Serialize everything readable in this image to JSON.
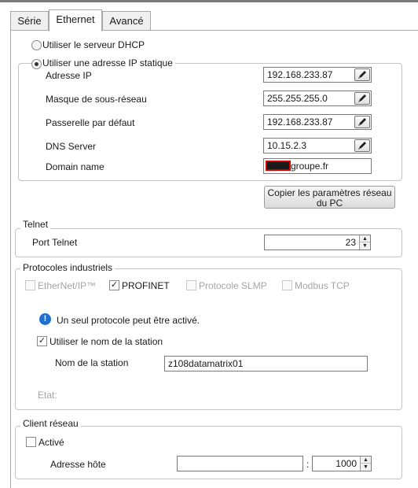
{
  "tabs": [
    {
      "label": "Série"
    },
    {
      "label": "Ethernet"
    },
    {
      "label": "Avancé"
    }
  ],
  "ip": {
    "dhcp_label": "Utiliser le serveur DHCP",
    "static_label": "Utiliser une adresse IP statique",
    "fields": [
      {
        "label": "Adresse IP",
        "value": "192.168.233.87"
      },
      {
        "label": "Masque de sous-réseau",
        "value": "255.255.255.0"
      },
      {
        "label": "Passerelle par défaut",
        "value": "192.168.233.87"
      },
      {
        "label": "DNS Server",
        "value": "10.15.2.3"
      }
    ],
    "domain_label": "Domain name",
    "domain_suffix": "groupe.fr",
    "copy_button": "Copier les paramètres réseau du PC"
  },
  "telnet": {
    "legend": "Telnet",
    "port_label": "Port Telnet",
    "port_value": "23"
  },
  "protocols": {
    "legend": "Protocoles industriels",
    "items": [
      {
        "label": "EtherNet/IP™",
        "checked": false,
        "enabled": false
      },
      {
        "label": "PROFINET",
        "checked": true,
        "enabled": true
      },
      {
        "label": "Protocole SLMP",
        "checked": false,
        "enabled": false
      },
      {
        "label": "Modbus TCP",
        "checked": false,
        "enabled": false
      }
    ],
    "info_text": "Un seul protocole peut être activé.",
    "use_station_label": "Utiliser le nom de la station",
    "station_label": "Nom de la station",
    "station_value": "z108datamatrix01",
    "state_label": "Etat:"
  },
  "client": {
    "legend": "Client réseau",
    "active_label": "Activé",
    "host_label": "Adresse hôte",
    "host_value": "",
    "separator": ":",
    "port_value": "1000"
  },
  "colors": {
    "redaction": "#1a1a1a",
    "redaction_border": "#d40000",
    "info_icon": "#1f6fd1"
  }
}
